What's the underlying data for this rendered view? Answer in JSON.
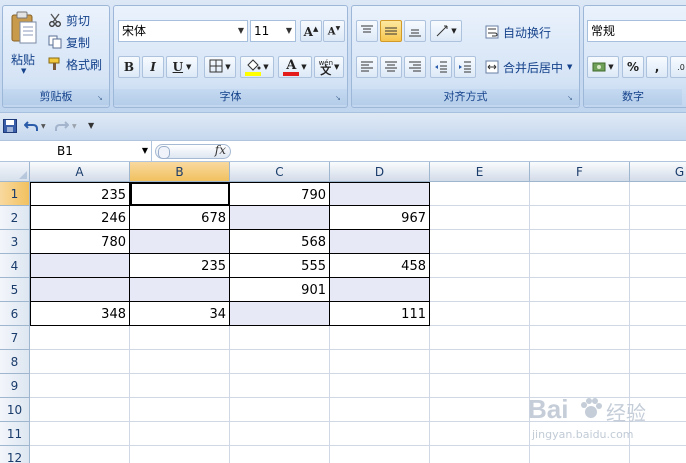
{
  "ribbon": {
    "clipboard": {
      "paste_label": "粘贴",
      "cut_label": "剪切",
      "copy_label": "复制",
      "format_painter_label": "格式刷",
      "group_label": "剪贴板"
    },
    "font": {
      "font_name": "宋体",
      "font_size": "11",
      "bold": "B",
      "italic": "I",
      "underline": "U",
      "font_color_glyph": "A",
      "phonetic_glyph": "wén",
      "group_label": "字体"
    },
    "alignment": {
      "wrap_text_label": "自动换行",
      "merge_center_label": "合并后居中",
      "group_label": "对齐方式"
    },
    "number": {
      "format_value": "常规",
      "percent": "%",
      "comma": ",",
      "group_label": "数字"
    }
  },
  "formula_bar": {
    "name_box": "B1",
    "fx_label": "fx",
    "formula": ""
  },
  "columns": [
    "A",
    "B",
    "C",
    "D",
    "E",
    "F",
    "G"
  ],
  "rows": [
    "1",
    "2",
    "3",
    "4",
    "5",
    "6",
    "7",
    "8",
    "9",
    "10",
    "11",
    "12"
  ],
  "grid": [
    {
      "A": "235",
      "B": "",
      "C": "790",
      "D": ""
    },
    {
      "A": "246",
      "B": "678",
      "C": "",
      "D": "967"
    },
    {
      "A": "780",
      "B": "",
      "C": "568",
      "D": ""
    },
    {
      "A": "",
      "B": "235",
      "C": "555",
      "D": "458"
    },
    {
      "A": "",
      "B": "",
      "C": "901",
      "D": ""
    },
    {
      "A": "348",
      "B": "34",
      "C": "",
      "D": "111"
    }
  ],
  "selected_cell": "B1",
  "watermark": {
    "brand": "Bai",
    "brand2": "经验",
    "url": "jingyan.baidu.com"
  },
  "colors": {
    "shaded_cell": "#e7e9f6",
    "selected_header": "#f1c15f",
    "font_color_bar": "#e31b1b",
    "highlight_bar": "#ffff00"
  }
}
